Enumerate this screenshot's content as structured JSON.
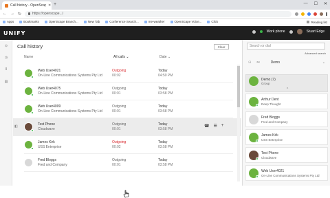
{
  "browser": {
    "tab_title": "Call history - OpenScape UC",
    "url": "https://openscape.../",
    "bookmarks": [
      "Apps",
      "Bookmarks",
      "OpenScape Branch...",
      "New Tab",
      "Conference Search...",
      "me-weather",
      "OpenScape Voice...",
      "Click"
    ],
    "reading_list": "Reading list"
  },
  "app": {
    "logo": "UNIFY",
    "work_phone": "Work phone",
    "user_name": "Stuart Edge"
  },
  "main": {
    "title": "Call history",
    "clear_label": "Clear",
    "columns": {
      "name": "Name",
      "filter": "All calls",
      "date": "Date"
    },
    "rows": [
      {
        "name": "Web User4021",
        "sub": "On-Line Communications Systems Pty Ltd",
        "direction": "Outgoing",
        "duration": "00:02",
        "day": "Today",
        "time": "04:50 PM",
        "avatar": "group",
        "direction_color": "#d8282d"
      },
      {
        "name": "Web User4075",
        "sub": "On-Line Communications Systems Pty Ltd",
        "direction": "Outgoing",
        "duration": "00:01",
        "day": "Today",
        "time": "03:58 PM",
        "avatar": "group",
        "direction_color": "#666666"
      },
      {
        "name": "Web User4009",
        "sub": "On-Line Communications Systems Pty Ltd",
        "direction": "Outgoing",
        "duration": "00:01",
        "day": "Today",
        "time": "03:58 PM",
        "avatar": "group",
        "direction_color": "#666666"
      },
      {
        "name": "Test Phone",
        "sub": "Cloudwave",
        "direction": "Outgoing",
        "duration": "00:01",
        "day": "Today",
        "time": "03:58 PM",
        "avatar": "photo",
        "direction_color": "#666666"
      },
      {
        "name": "James Kirk",
        "sub": "USS Enterprise",
        "direction": "Outgoing",
        "duration": "00:02",
        "day": "Today",
        "time": "03:58 PM",
        "avatar": "group",
        "direction_color": "#d8282d"
      },
      {
        "name": "Fred Bloggs",
        "sub": "Fred and Company",
        "direction": "Outgoing",
        "duration": "00:01",
        "day": "Today",
        "time": "03:58 PM",
        "avatar": "person",
        "direction_color": "#666666"
      }
    ],
    "row_actions": [
      "☎",
      "☰",
      "+"
    ]
  },
  "right_panel": {
    "search_placeholder": "Search or dial",
    "advanced_search": "Advanced search",
    "filter_label": "Demo",
    "group": {
      "name": "Demo (7)",
      "sub": "Group"
    },
    "contacts": [
      {
        "name": "Arthur Dent",
        "sub": "Deep Thought",
        "avatar": "group"
      },
      {
        "name": "Fred Bloggs",
        "sub": "Fred and Company",
        "avatar": "person"
      },
      {
        "name": "James Kirk",
        "sub": "USS Enterprise",
        "avatar": "group"
      },
      {
        "name": "Test Phone",
        "sub": "Cloudwave",
        "avatar": "photo"
      },
      {
        "name": "Web User4021",
        "sub": "On-Line Communications Systems Pty Ltd",
        "avatar": "group"
      }
    ]
  }
}
